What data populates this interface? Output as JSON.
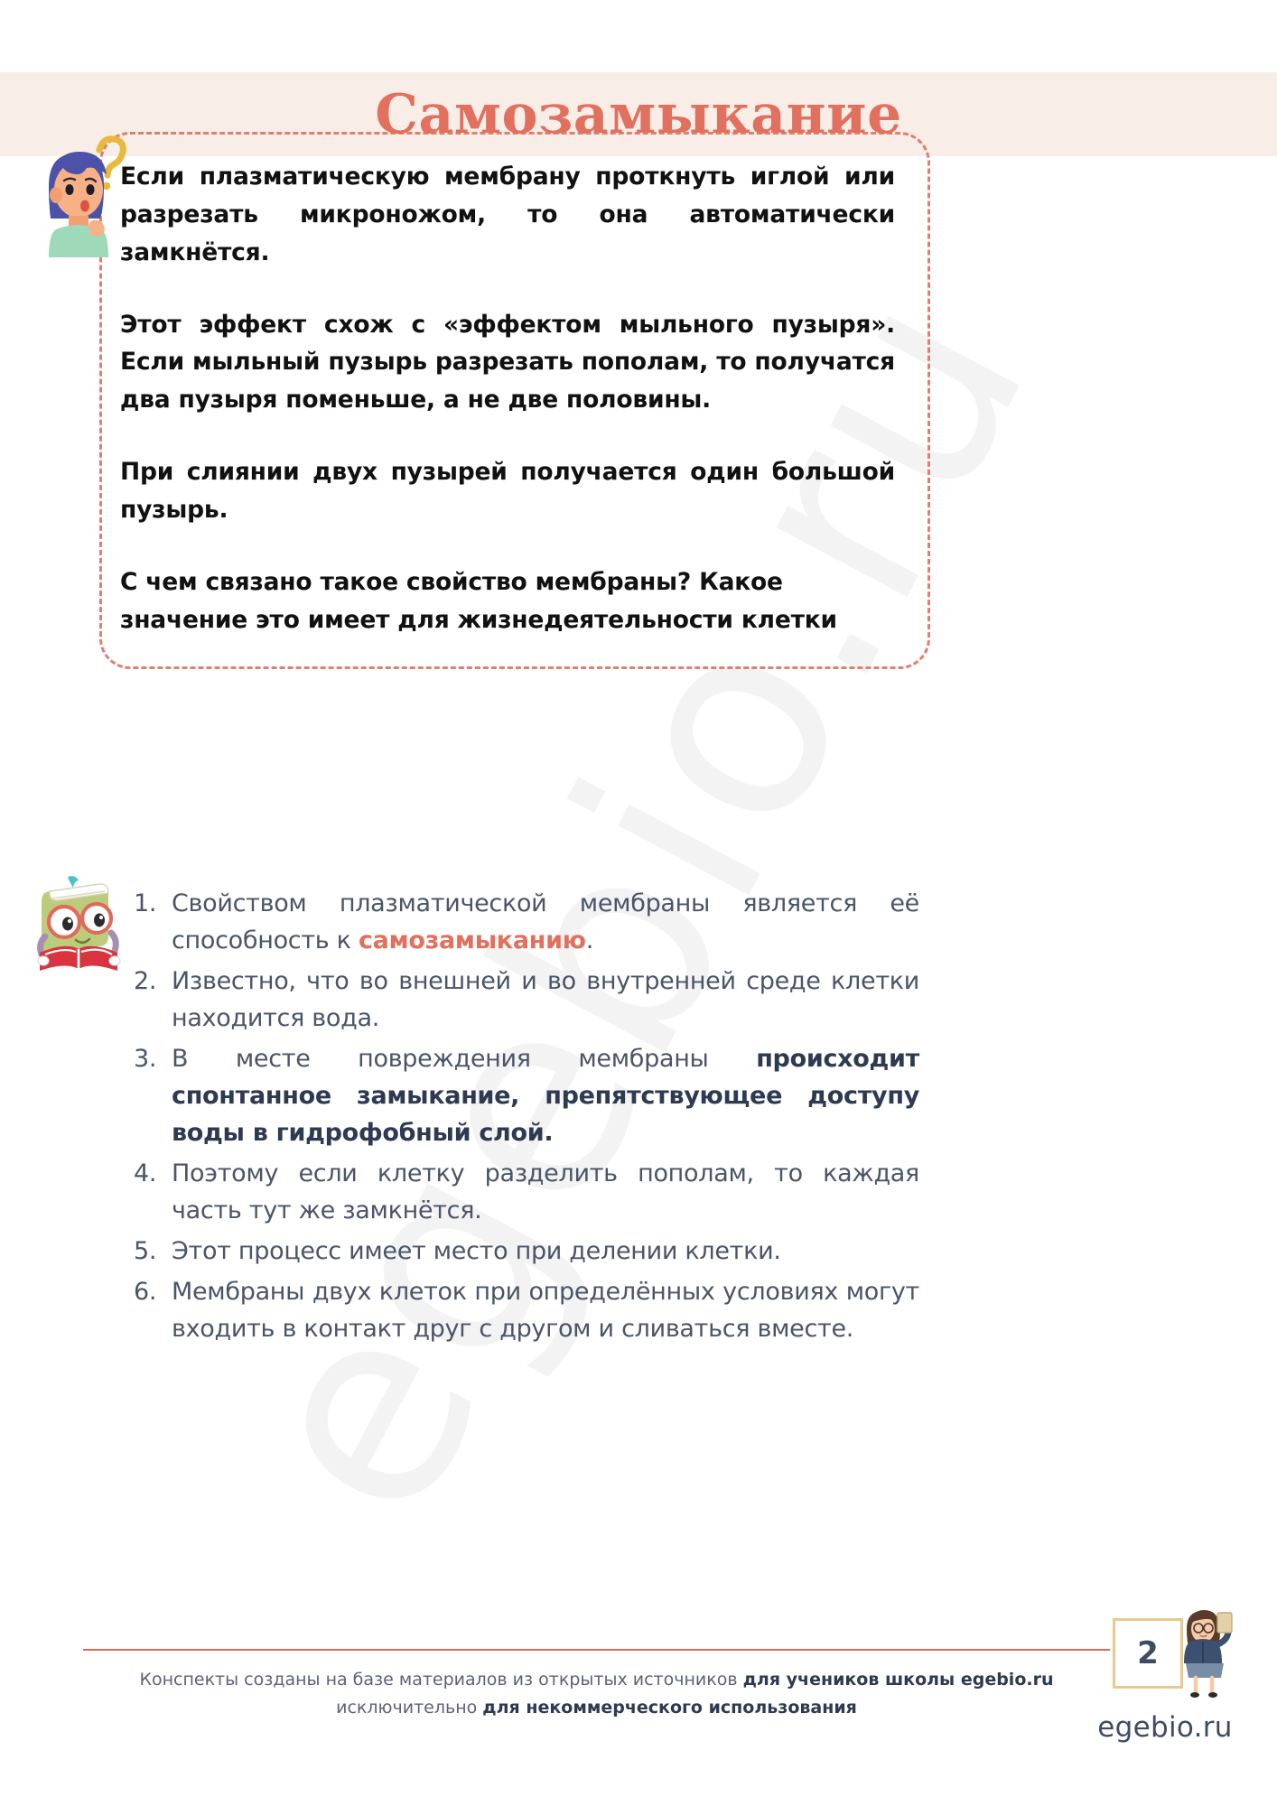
{
  "page": {
    "title": "Самозамыкание",
    "page_number": "2",
    "brand": "egebio.ru",
    "watermark_text": "egebio.ru"
  },
  "colors": {
    "accent_coral": "#E2705E",
    "header_band": "#F8EEE7",
    "box_border": "#DE8070",
    "body_text": "#111111",
    "list_text": "#4A5568",
    "bold_navy": "#2D3A52",
    "page_box_border": "#E8C98C",
    "footer_rule": "#D9695C"
  },
  "icons": {
    "girl_thinking": "girl-thinking-icon",
    "question_mark": "question-mark-icon",
    "book_owl": "book-character-icon",
    "teacher": "teacher-icon"
  },
  "question_box": {
    "paragraphs": [
      "Если плазматическую мембрану проткнуть иглой или разрезать микроножом, то она автоматически замкнётся.",
      "Этот эффект схож с «эффектом мыльного пузыря». Если мыльный пузырь разрезать пополам, то получатся два пузыря поменьше, а не две половины.",
      "При слиянии двух пузырей получается один большой пузырь.",
      "С чем связано такое свойство мембраны? Какое значение это имеет для жизнедеятельности клетки"
    ]
  },
  "answers": [
    {
      "number": "1.",
      "parts": [
        {
          "text": "Свойством плазматической мембраны является её способность к ",
          "style": "normal"
        },
        {
          "text": "самозамыканию",
          "style": "coral"
        },
        {
          "text": ".",
          "style": "normal"
        }
      ]
    },
    {
      "number": "2.",
      "parts": [
        {
          "text": "Известно, что во внешней и во внутренней среде клетки находится вода.",
          "style": "normal"
        }
      ]
    },
    {
      "number": "3.",
      "parts": [
        {
          "text": "В месте повреждения мембраны ",
          "style": "normal"
        },
        {
          "text": "происходит спонтанное замыкание, препятствующее доступу воды в гидрофобный слой.",
          "style": "navy"
        }
      ]
    },
    {
      "number": "4.",
      "parts": [
        {
          "text": "Поэтому если клетку разделить пополам, то каждая часть тут же замкнётся.",
          "style": "normal"
        }
      ]
    },
    {
      "number": "5.",
      "parts": [
        {
          "text": "Этот процесс имеет место при делении клетки.",
          "style": "normal"
        }
      ]
    },
    {
      "number": "6.",
      "parts": [
        {
          "text": "Мембраны двух клеток при определённых условиях могут входить в контакт друг с другом и сливаться вместе.",
          "style": "normal"
        }
      ]
    }
  ],
  "footer": {
    "line1_plain_a": "Конспекты созданы на базе материалов из открытых источников ",
    "line1_bold": "для учеников школы egebio.ru",
    "line2_plain": "исключительно ",
    "line2_bold": "для некоммерческого использования"
  }
}
